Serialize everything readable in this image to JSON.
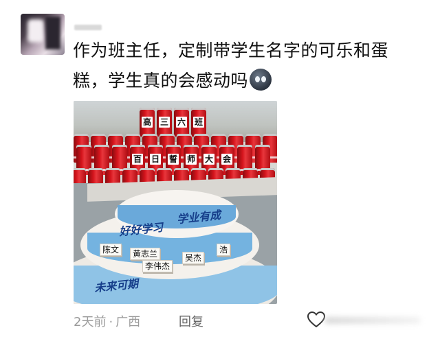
{
  "post": {
    "text": "作为班主任，定制带学生名字的可乐和蛋糕，学生真的会感动吗",
    "emoji_icon": "thinking-face-emoji"
  },
  "photo": {
    "can_characters": [
      "高",
      "三",
      "六",
      "班",
      "百",
      "日",
      "誓",
      "师",
      "大",
      "会"
    ],
    "cake_script_text": [
      "好好学习",
      "学业有成",
      "未来可期"
    ],
    "name_tags": [
      "陈文",
      "黄志兰",
      "李伟杰",
      "吴杰",
      "浩"
    ]
  },
  "meta": {
    "time": "2天前",
    "separator": "·",
    "location": "广西",
    "reply_label": "回复"
  },
  "colors": {
    "accent_red": "#d4141c",
    "meta_gray": "#9b9b9b",
    "cake_blue": "#74b3e0"
  }
}
